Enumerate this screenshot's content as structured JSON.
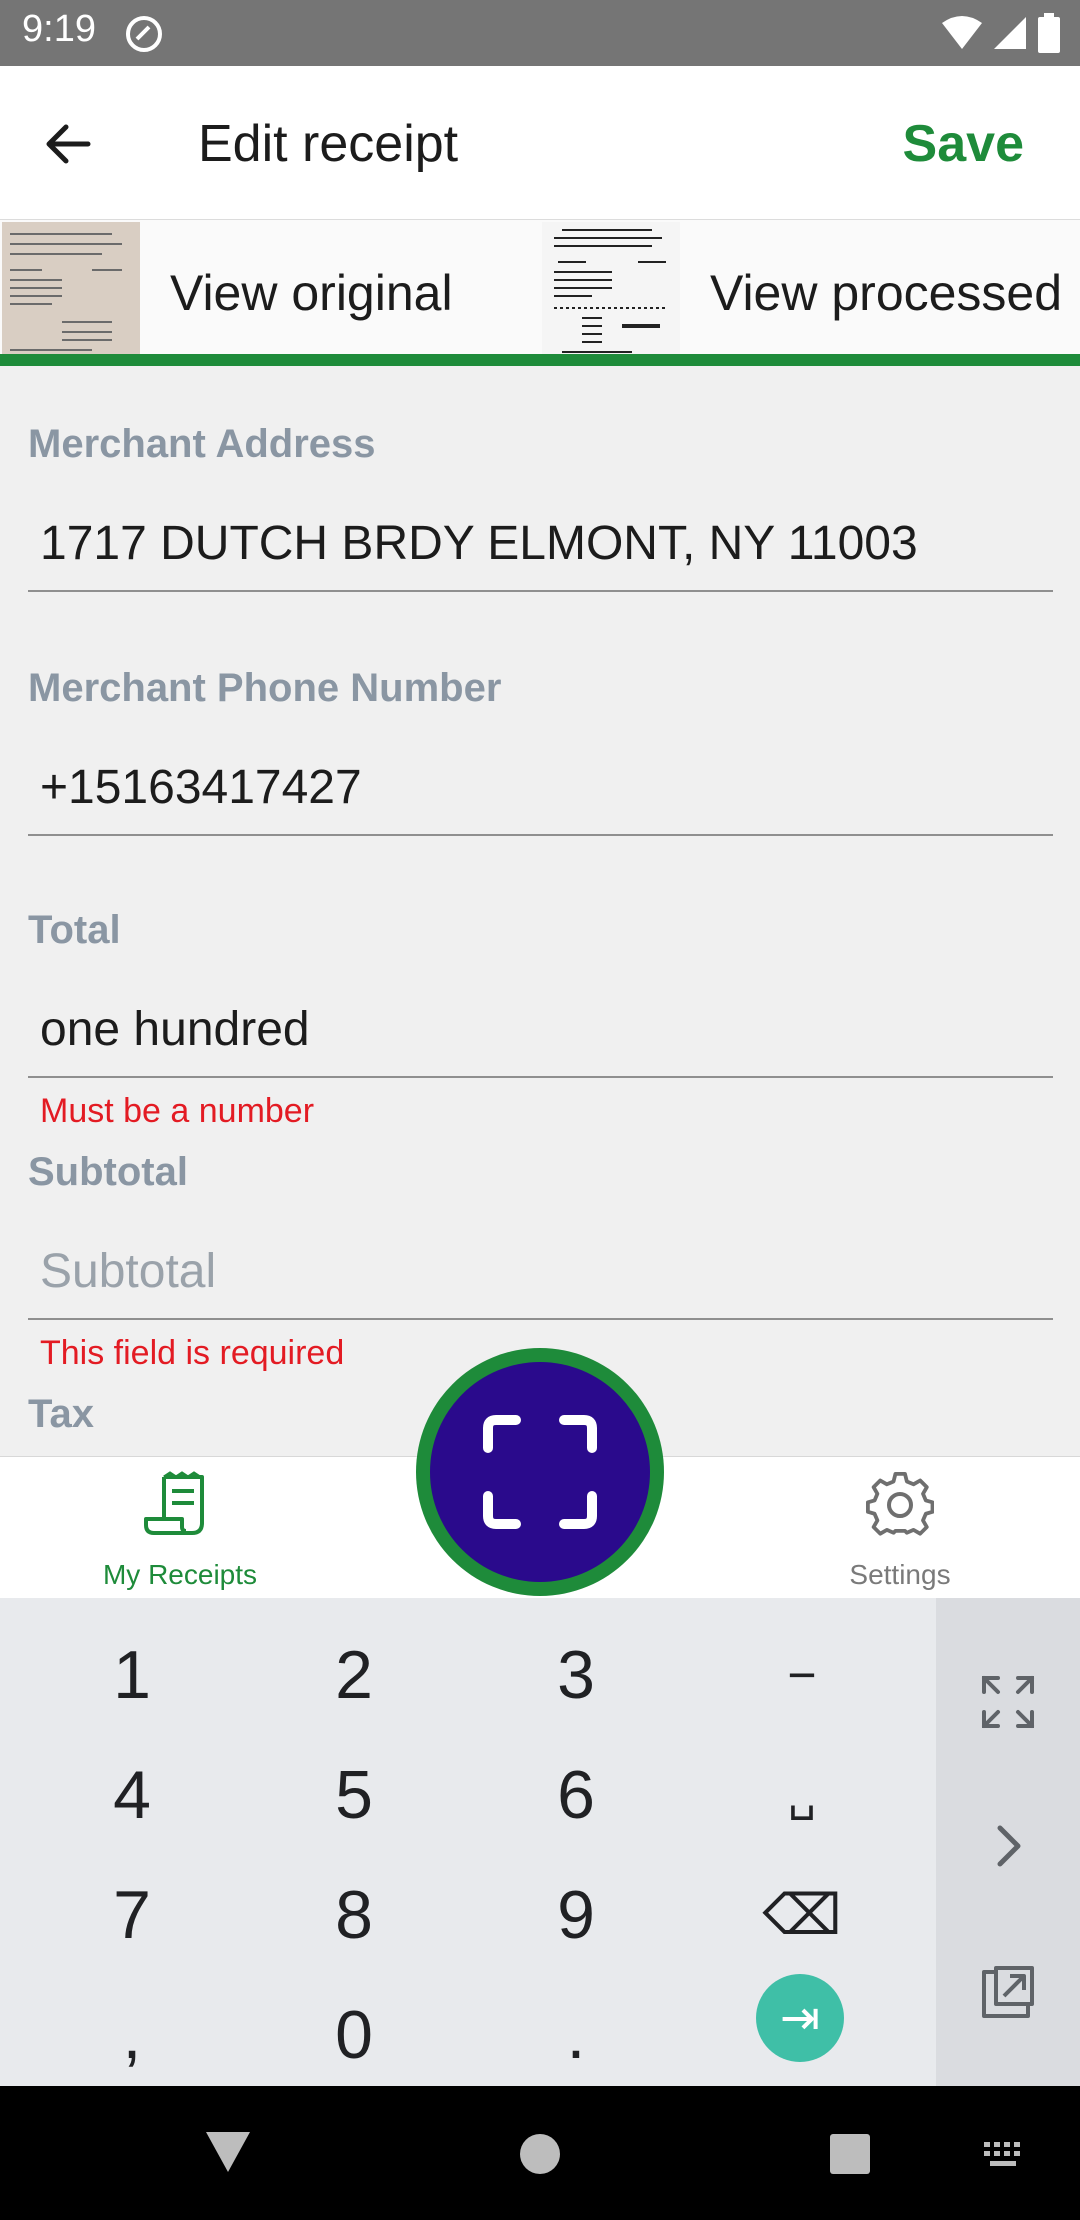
{
  "status_bar": {
    "time": "9:19",
    "icons": [
      "at-sign-icon",
      "wifi-icon",
      "signal-icon",
      "battery-icon"
    ]
  },
  "app_bar": {
    "back_icon": "arrow-left-icon",
    "title": "Edit receipt",
    "save_label": "Save"
  },
  "image_tabs": {
    "original_label": "View original",
    "processed_label": "View processed"
  },
  "form": {
    "fields": [
      {
        "label": "Merchant Address",
        "value": "1717 DUTCH BRDY ELMONT, NY 11003",
        "placeholder": "",
        "error": ""
      },
      {
        "label": "Merchant Phone Number",
        "value": "+15163417427",
        "placeholder": "",
        "error": ""
      },
      {
        "label": "Total",
        "value": "one hundred",
        "placeholder": "",
        "error": "Must be a number"
      },
      {
        "label": "Subtotal",
        "value": "",
        "placeholder": "Subtotal",
        "error": "This field is required"
      },
      {
        "label": "Tax",
        "value": "",
        "placeholder": "",
        "error": ""
      }
    ]
  },
  "bottom_nav": {
    "items": [
      {
        "label": "My Receipts",
        "icon": "receipt-icon",
        "active": true
      },
      {
        "label": "Settings",
        "icon": "gear-icon",
        "active": false
      }
    ],
    "fab_icon": "scan-icon"
  },
  "keyboard": {
    "keys": [
      "1",
      "2",
      "3",
      "−",
      "4",
      "5",
      "6",
      "␣",
      "7",
      "8",
      "9",
      "⌫",
      ",",
      "0",
      ".",
      "⇥"
    ],
    "side_icons": [
      "fullscreen-icon",
      "chevron-right-icon",
      "popout-icon"
    ]
  },
  "colors": {
    "accent_green": "#1e8b3a",
    "fab_purple": "#2a0a8c",
    "error_red": "#e31b23",
    "label_gray": "#8a96a3"
  }
}
